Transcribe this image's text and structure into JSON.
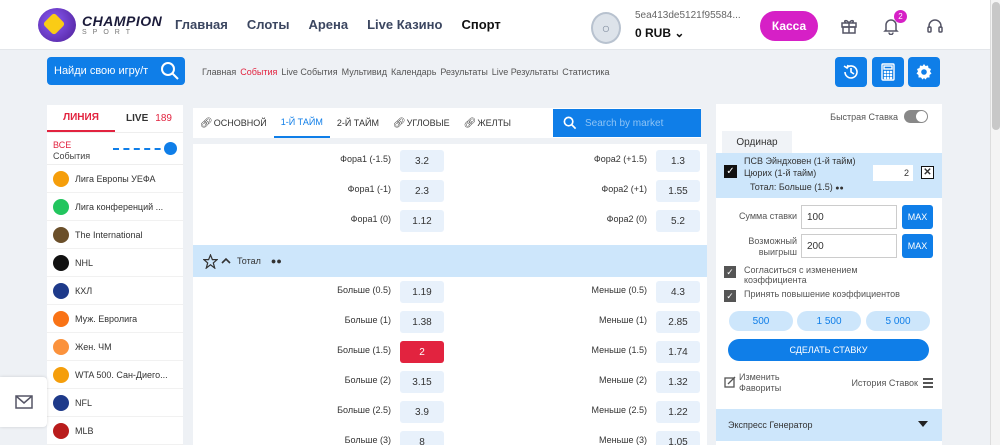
{
  "brand": {
    "line1": "CHAMPION",
    "line2": "SPORT"
  },
  "nav": {
    "items": [
      "Главная",
      "Слоты",
      "Арена",
      "Live Казино",
      "Спорт"
    ],
    "active": "Спорт"
  },
  "account": {
    "id": "5ea413de5121f95584...",
    "balance": "0 RUB",
    "cashier": "Касса",
    "notifications": "2"
  },
  "search": {
    "placeholder": "Найди свою игру/т"
  },
  "subnav": [
    "Главная",
    "События",
    "Live События",
    "Мультивид",
    "Календарь",
    "Результаты",
    "Live Результаты",
    "Статистика"
  ],
  "subnav_active": "События",
  "toolbar_icons": [
    "history-icon",
    "calculator-icon",
    "settings-icon"
  ],
  "sidebar": {
    "tab_line": "ЛИНИЯ",
    "tab_live": "LIVE",
    "live_count": "189",
    "all_label": "ВСЕ",
    "events_label": "События",
    "leagues": [
      {
        "name": "Лига Европы УЕФА",
        "color": "#f59e0b"
      },
      {
        "name": "Лига конференций ...",
        "color": "#22c55e"
      },
      {
        "name": "The International",
        "color": "#6b4f2a"
      },
      {
        "name": "NHL",
        "color": "#111111"
      },
      {
        "name": "КХЛ",
        "color": "#1e3a8a"
      },
      {
        "name": "Муж. Евролига",
        "color": "#f97316"
      },
      {
        "name": "Жен. ЧМ",
        "color": "#fb923c"
      },
      {
        "name": "WTA 500. Сан-Диего...",
        "color": "#f59e0b"
      },
      {
        "name": "NFL",
        "color": "#1e3a8a"
      },
      {
        "name": "MLB",
        "color": "#b91c1c"
      }
    ]
  },
  "market_tabs": [
    "ОСНОВНОЙ",
    "1-Й ТАЙМ",
    "2-Й ТАЙМ",
    "УГЛОВЫЕ",
    "ЖЕЛТЫ"
  ],
  "market_search_placeholder": "Search by market",
  "handicap_rows": [
    {
      "left": "Фора1 (-1.5)",
      "left_odd": "3.2",
      "right": "Фора2 (+1.5)",
      "right_odd": "1.3"
    },
    {
      "left": "Фора1 (-1)",
      "left_odd": "2.3",
      "right": "Фора2 (+1)",
      "right_odd": "1.55"
    },
    {
      "left": "Фора1 (0)",
      "left_odd": "1.12",
      "right": "Фора2 (0)",
      "right_odd": "5.2"
    }
  ],
  "total_header": "Тотал",
  "total_rows": [
    {
      "left": "Больше (0.5)",
      "left_odd": "1.19",
      "right": "Меньше (0.5)",
      "right_odd": "4.3"
    },
    {
      "left": "Больше (1)",
      "left_odd": "1.38",
      "right": "Меньше (1)",
      "right_odd": "2.85"
    },
    {
      "left": "Больше (1.5)",
      "left_odd": "2",
      "right": "Меньше (1.5)",
      "right_odd": "1.74",
      "selected": "left"
    },
    {
      "left": "Больше (2)",
      "left_odd": "3.15",
      "right": "Меньше (2)",
      "right_odd": "1.32"
    },
    {
      "left": "Больше (2.5)",
      "left_odd": "3.9",
      "right": "Меньше (2.5)",
      "right_odd": "1.22"
    },
    {
      "left": "Больше (3)",
      "left_odd": "8",
      "right": "Меньше (3)",
      "right_odd": "1.05"
    }
  ],
  "betslip": {
    "quick_bet": "Быстрая Ставка",
    "tab": "Ординар",
    "team1": "ПСВ Эйндховен (1-й тайм)",
    "team2": "Цюрих (1-й тайм)",
    "market": "Тотал: Больше (1.5)",
    "odd": "2",
    "stake_label": "Сумма ставки",
    "stake": "100",
    "win_label_1": "Возможный",
    "win_label_2": "выигрыш",
    "win": "200",
    "max": "MAX",
    "accept_change_1": "Согласиться с изменением",
    "accept_change_2": "коэффициента",
    "accept_increase": "Принять повышение коэффициентов",
    "amounts": [
      "500",
      "1 500",
      "5 000"
    ],
    "place": "СДЕЛАТЬ СТАВКУ",
    "fav_1": "Изменить",
    "fav_2": "Фавориты",
    "history": "История Ставок",
    "express": "Экспресс Генератор"
  }
}
